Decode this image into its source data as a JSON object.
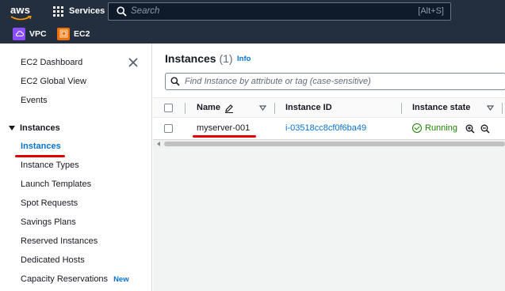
{
  "topnav": {
    "logo_text": "aws",
    "services_label": "Services",
    "search_placeholder": "Search",
    "search_shortcut": "[Alt+S]",
    "favorites": [
      {
        "label": "VPC",
        "icon": "vpc-icon",
        "color": "#8c4fff"
      },
      {
        "label": "EC2",
        "icon": "ec2-icon",
        "color": "#ed7100"
      }
    ]
  },
  "sidebar": {
    "items_top": [
      "EC2 Dashboard",
      "EC2 Global View",
      "Events"
    ],
    "section_label": "Instances",
    "section_items": [
      {
        "label": "Instances",
        "active": true
      },
      {
        "label": "Instance Types"
      },
      {
        "label": "Launch Templates"
      },
      {
        "label": "Spot Requests"
      },
      {
        "label": "Savings Plans"
      },
      {
        "label": "Reserved Instances"
      },
      {
        "label": "Dedicated Hosts"
      },
      {
        "label": "Capacity Reservations",
        "badge": "New"
      }
    ]
  },
  "main": {
    "title": "Instances",
    "count": "(1)",
    "info_label": "Info",
    "find_placeholder": "Find Instance by attribute or tag (case-sensitive)",
    "columns": [
      "Name",
      "Instance ID",
      "Instance state"
    ],
    "rows": [
      {
        "name": "myserver-001",
        "instance_id": "i-03518cc8cf0f6ba49",
        "state": "Running"
      }
    ]
  },
  "colors": {
    "nav_bg": "#232f3e",
    "link": "#0972d3",
    "running": "#1d8102",
    "annotation": "#e00000"
  }
}
